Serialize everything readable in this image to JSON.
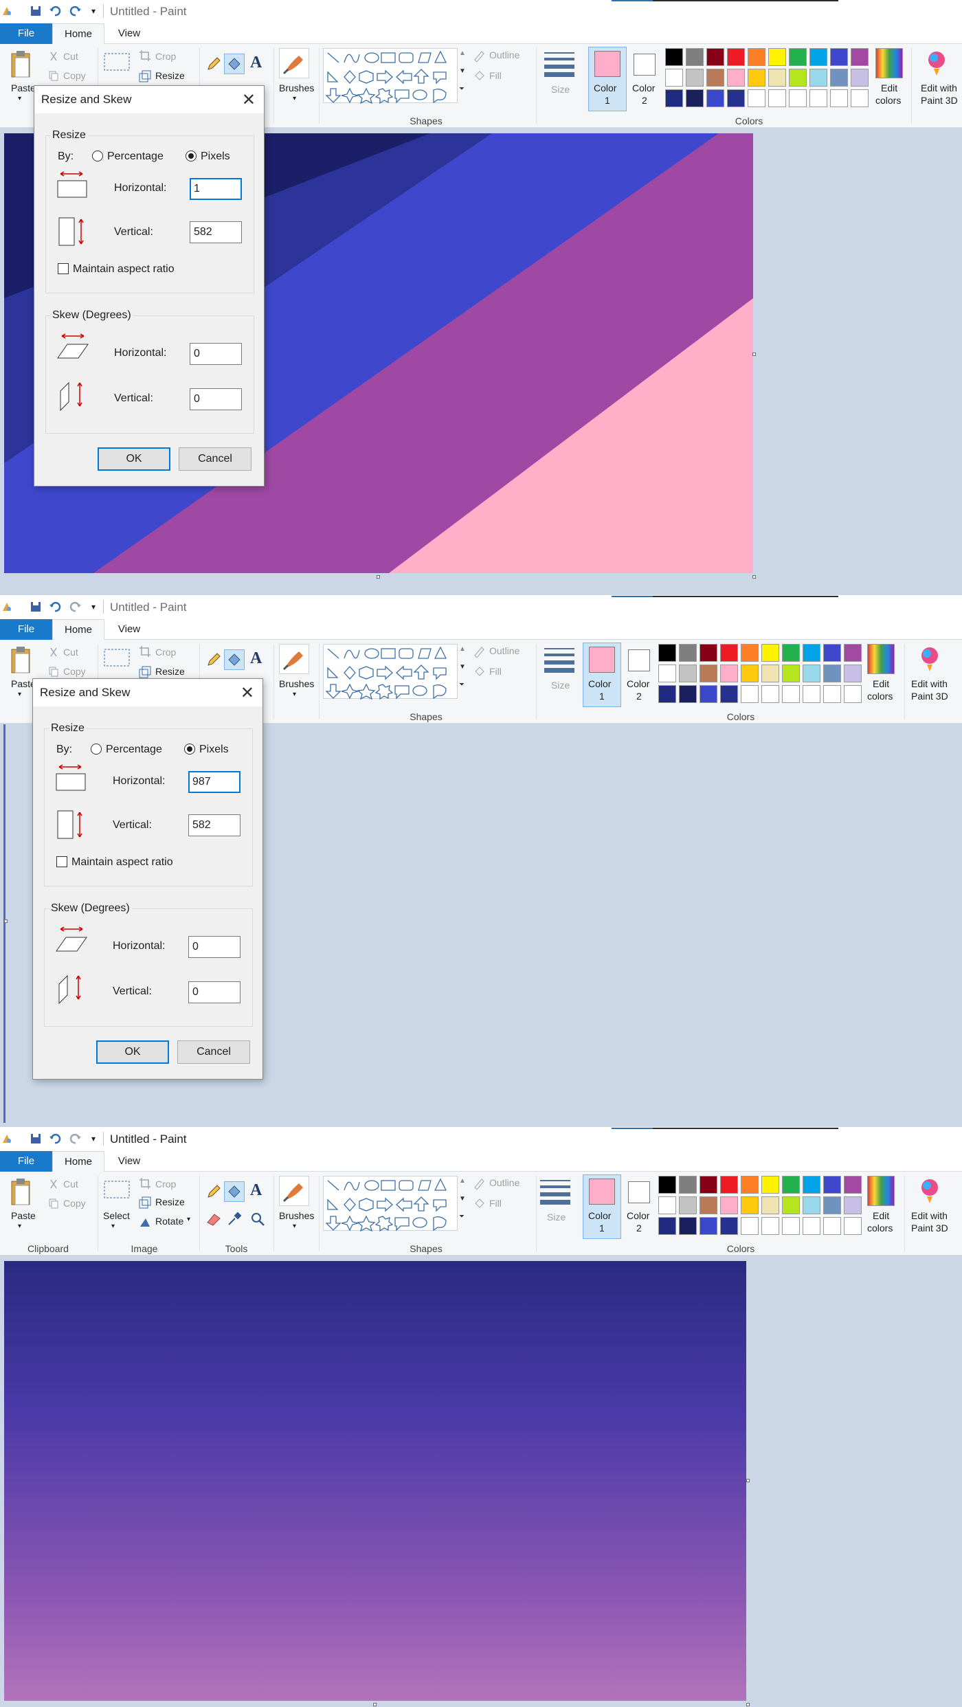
{
  "app": {
    "title": "Untitled - Paint",
    "tabs": {
      "file": "File",
      "home": "Home",
      "view": "View"
    },
    "ribbon": {
      "clipboard": {
        "paste": "Paste",
        "cut": "Cut",
        "copy": "Copy",
        "group": "Clipboard"
      },
      "image": {
        "select": "Select",
        "crop": "Crop",
        "resize": "Resize",
        "rotate": "Rotate",
        "group": "Image"
      },
      "tools": {
        "group": "Tools"
      },
      "brushes": "Brushes",
      "shapes": {
        "outline": "Outline",
        "fill": "Fill",
        "group": "Shapes"
      },
      "size": "Size",
      "color1": "Color\n1",
      "color1_line1": "Color",
      "color1_line2": "1",
      "color2_line1": "Color",
      "color2_line2": "2",
      "edit_colors_1": "Edit",
      "edit_colors_2": "colors",
      "paint3d_1": "Edit with",
      "paint3d_2": "Paint 3D",
      "colors_group": "Colors"
    },
    "palette_row1": [
      "#000000",
      "#7f7f7f",
      "#880015",
      "#ed1c24",
      "#ff7f27",
      "#fff200",
      "#22b14c",
      "#00a2e8",
      "#3f48cc",
      "#a349a4"
    ],
    "palette_row2": [
      "#ffffff",
      "#c3c3c3",
      "#b97a57",
      "#ffaec9",
      "#ffc90e",
      "#efe4b0",
      "#b5e61d",
      "#99d9ea",
      "#7092be",
      "#c8bfe7"
    ],
    "palette_row3": [
      "#1f2a80",
      "#1a1f5e",
      "#3b48cc",
      "#26308f",
      "#ffffff",
      "#ffffff",
      "#ffffff",
      "#ffffff",
      "#ffffff",
      "#ffffff"
    ],
    "color1_value": "#ffaec9",
    "color2_value": "#ffffff"
  },
  "dialog": {
    "title": "Resize and Skew",
    "resize_legend": "Resize",
    "by": "By:",
    "percentage": "Percentage",
    "pixels": "Pixels",
    "horizontal": "Horizontal:",
    "vertical": "Vertical:",
    "maintain": "Maintain aspect ratio",
    "skew_legend": "Skew (Degrees)",
    "ok": "OK",
    "cancel": "Cancel"
  },
  "frames": [
    {
      "resize_horizontal": "1",
      "resize_vertical": "582",
      "skew_horizontal": "0",
      "skew_vertical": "0"
    },
    {
      "resize_horizontal": "987",
      "resize_vertical": "582",
      "skew_horizontal": "0",
      "skew_vertical": "0"
    }
  ]
}
